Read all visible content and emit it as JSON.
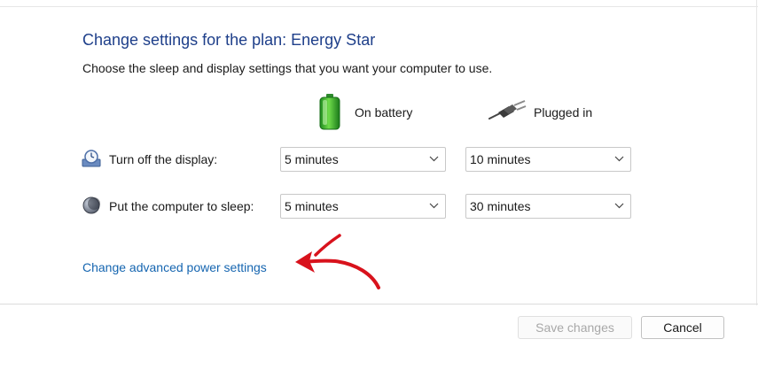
{
  "page": {
    "title": "Change settings for the plan: Energy Star",
    "subtitle": "Choose the sleep and display settings that you want your computer to use.",
    "link_advanced": "Change advanced power settings"
  },
  "columns": {
    "battery": {
      "label": "On battery",
      "icon": "battery-icon"
    },
    "plugged": {
      "label": "Plugged in",
      "icon": "power-plug-icon"
    }
  },
  "rows": [
    {
      "label": "Turn off the display:",
      "icon": "display-clock-icon",
      "battery_value": "5 minutes",
      "plugged_value": "10 minutes"
    },
    {
      "label": "Put the computer to sleep:",
      "icon": "sleep-moon-icon",
      "battery_value": "5 minutes",
      "plugged_value": "30 minutes"
    }
  ],
  "buttons": {
    "save": "Save changes",
    "cancel": "Cancel"
  },
  "colors": {
    "title": "#1e3f8a",
    "link": "#1565b0",
    "annotation_arrow": "#d8121c",
    "disabled_text": "#a8a8a8"
  }
}
